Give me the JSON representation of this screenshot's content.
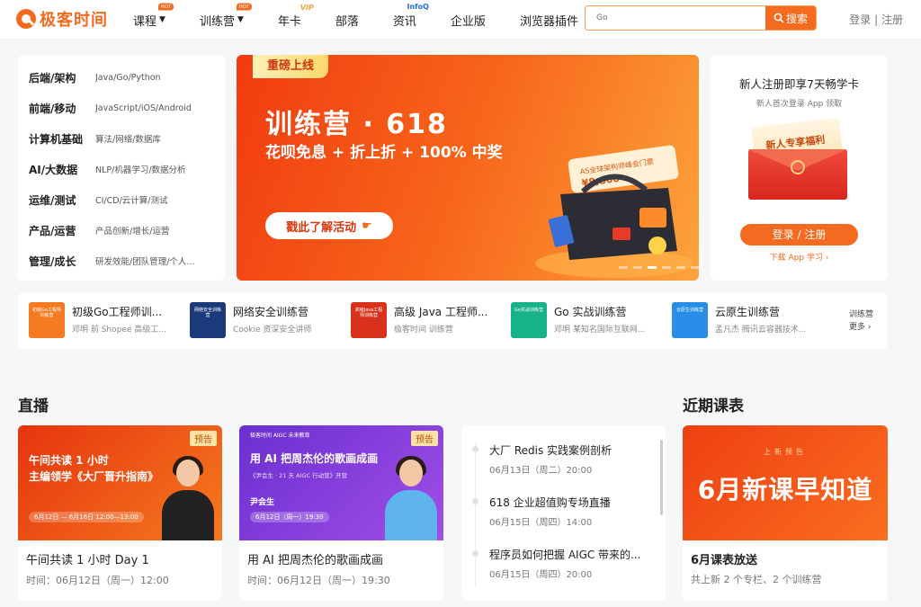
{
  "header": {
    "logo_text": "极客时间",
    "nav": [
      {
        "label": "课程",
        "badge": "HOT",
        "has_chevron": true
      },
      {
        "label": "训练营",
        "badge": "HOT",
        "has_chevron": true
      },
      {
        "label": "年卡",
        "badge": "VIP",
        "has_chevron": false
      },
      {
        "label": "部落",
        "badge": "",
        "has_chevron": false
      },
      {
        "label": "资讯",
        "badge": "InfoQ",
        "has_chevron": false
      },
      {
        "label": "企业版",
        "badge": "",
        "has_chevron": false
      },
      {
        "label": "浏览器插件",
        "badge": "",
        "has_chevron": false
      }
    ],
    "search_placeholder": "Go",
    "search_button": "搜索",
    "login": "登录",
    "separator": "|",
    "register": "注册"
  },
  "categories": [
    {
      "title": "后端/架构",
      "sub": "Java/Go/Python"
    },
    {
      "title": "前端/移动",
      "sub": "JavaScript/iOS/Android"
    },
    {
      "title": "计算机基础",
      "sub": "算法/网络/数据库"
    },
    {
      "title": "AI/大数据",
      "sub": "NLP/机器学习/数据分析"
    },
    {
      "title": "运维/测试",
      "sub": "CI/CD/云计算/测试"
    },
    {
      "title": "产品/运营",
      "sub": "产品创新/增长/运营"
    },
    {
      "title": "管理/成长",
      "sub": "研发效能/团队管理/个人..."
    }
  ],
  "banner": {
    "tag": "重磅上线",
    "title": "训练营 · 618",
    "subtitle": "花呗免息 + 折上折 + 100% 中奖",
    "cta": "戳此了解活动",
    "art_label": "AS全球架构师峰会门票",
    "art_price": "¥8,800",
    "slides_total": 6,
    "slide_active": 3
  },
  "promo": {
    "title": "新人注册即享7天畅学卡",
    "subtitle": "新人首次登录 App 领取",
    "card_text": "新人专享福利",
    "button": "登录 / 注册",
    "link": "下载 App 学习 ›"
  },
  "camps": [
    {
      "title": "初级Go工程师训...",
      "sub": "邓明 前 Shopee 高级工...",
      "thumb_text": "初级Go工程师训练营",
      "color": "#f57b22"
    },
    {
      "title": "网络安全训练营",
      "sub": "Cookie 资深安全讲师",
      "thumb_text": "网络安全训练营",
      "color": "#1b3a7a"
    },
    {
      "title": "高级 Java 工程师...",
      "sub": "极客时间 训练营",
      "thumb_text": "高级Java工程师训练营",
      "color": "#d8321d"
    },
    {
      "title": "Go 实战训练营",
      "sub": "邓明 某知名国际互联网...",
      "thumb_text": "Go实战训练营",
      "color": "#17b28a"
    },
    {
      "title": "云原生训练营",
      "sub": "孟凡杰 腾讯云容器技术...",
      "thumb_text": "云原生训练营",
      "color": "#2a8ee8"
    }
  ],
  "camps_more": {
    "line1": "训练营",
    "line2": "更多 ›"
  },
  "live": {
    "heading": "直播",
    "cards": [
      {
        "tag": "预告",
        "img_line1": "午间共读 1 小时",
        "img_line2": "主编领学《大厂晋升指南》",
        "img_date": "6月12日 — 6月16日 12:00—13:00",
        "title": "午间共读 1 小时 Day 1",
        "time": "时间：06月12日（周一）12:00"
      },
      {
        "tag": "预告",
        "img_brand": "极客时间 AIGC 未来教育",
        "img_title": "用 AI 把周杰伦的歌画成画",
        "img_sub": "《尹会生 · 21 天 AIGC 行动营》开营",
        "img_name": "尹会生",
        "img_date": "6月12日（周一）19:30",
        "title": "用 AI 把周杰伦的歌画成画",
        "time": "时间：06月12日（周一）19:30"
      }
    ],
    "list": [
      {
        "title": "大厂 Redis 实践案例剖析",
        "time": "06月13日（周二）20:00"
      },
      {
        "title": "618 企业超值购专场直播",
        "time": "06月15日（周四）14:00"
      },
      {
        "title": "程序员如何把握 AIGC 带来的...",
        "time": "06月15日（周四）20:00"
      }
    ]
  },
  "schedule": {
    "heading": "近期课表",
    "img_tag": "上新预告",
    "img_big": "6月新课早知道",
    "title": "6月课表放送",
    "sub": "共上新 2 个专栏、2 个训练营"
  },
  "colors": {
    "brand": "#f46a1e",
    "text": "#222222",
    "muted": "#777777"
  }
}
